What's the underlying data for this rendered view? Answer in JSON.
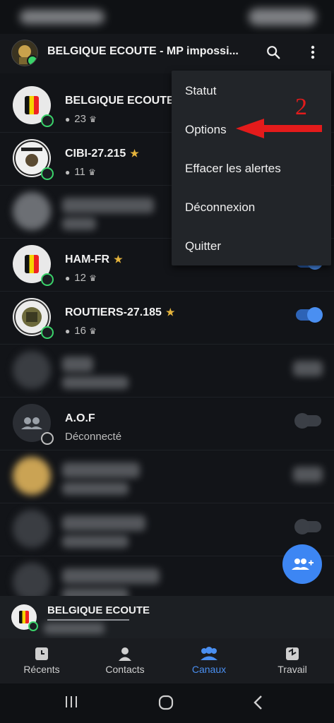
{
  "header": {
    "title": "BELGIQUE ECOUTE - MP impossi..."
  },
  "channels": [
    {
      "name": "BELGIQUE ECOUTE",
      "count": "23",
      "star": "★",
      "status": "on"
    },
    {
      "name": "CIBI-27.215",
      "count": "11",
      "star": "★",
      "status": "on"
    },
    {
      "name": "HAM-FR",
      "count": "12",
      "star": "★",
      "status": "on"
    },
    {
      "name": "ROUTIERS-27.185",
      "count": "16",
      "star": "★",
      "status": "on"
    },
    {
      "name": "A.O.F",
      "subtitle": "Déconnecté",
      "status": "off"
    }
  ],
  "menu": {
    "items": [
      "Statut",
      "Options",
      "Effacer les alertes",
      "Déconnexion",
      "Quitter"
    ]
  },
  "annotation": {
    "number": "2"
  },
  "current_channel": {
    "title": "BELGIQUE ECOUTE"
  },
  "tabs": [
    {
      "label": "Récents",
      "icon": "recent-icon"
    },
    {
      "label": "Contacts",
      "icon": "person-icon"
    },
    {
      "label": "Canaux",
      "icon": "group-icon",
      "active": true
    },
    {
      "label": "Travail",
      "icon": "work-icon"
    }
  ],
  "colors": {
    "accent": "#4a8ff1",
    "online": "#3ad36a",
    "star": "#e4b33c",
    "annotation": "#e41b1b"
  }
}
